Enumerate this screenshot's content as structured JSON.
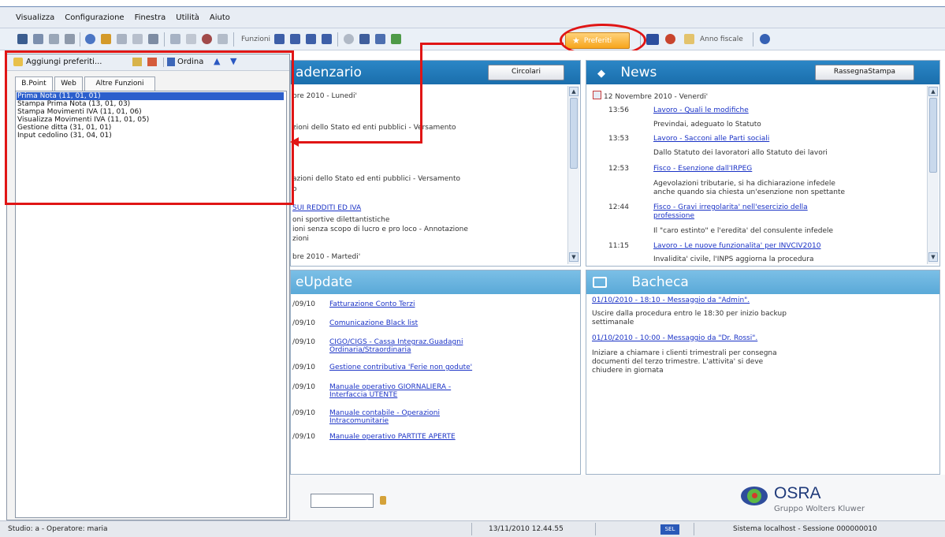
{
  "menu": [
    "Visualizza",
    "Configurazione",
    "Finestra",
    "Utilità",
    "Aiuto"
  ],
  "toolbar": {
    "funzioni_label": "Funzioni",
    "preferiti_label": "Preferiti",
    "anno_fiscale_label": "Anno fiscale"
  },
  "favorites": {
    "add_label": "Aggiungi preferiti...",
    "sort_label": "Ordina",
    "tabs": [
      "B.Point",
      "Web",
      "Altre Funzioni"
    ],
    "items": [
      "Prima Nota (11, 01, 01)",
      "Stampa Prima Nota (13, 01, 03)",
      "Stampa Movimenti IVA (11, 01, 06)",
      "Visualizza Movimenti IVA (11, 01, 05)",
      "Gestione ditta (31, 01, 01)",
      "Input cedolino (31, 04, 01)"
    ]
  },
  "scadenzario": {
    "title": "adenzario",
    "button": "Circolari",
    "lines": [
      "bre 2010 - Lunedi'",
      "zioni dello Stato ed enti pubblici - Versamento",
      "azioni dello Stato ed enti pubblici - Versamento",
      "o",
      "SUI REDDITI ED IVA",
      "oni  sportive  dilettantistiche",
      "ioni senza scopo di lucro e pro loco - Annotazione",
      "zioni",
      "bre 2010 - Martedi'"
    ]
  },
  "news": {
    "title": "News",
    "button": "RassegnaStampa",
    "date": "12 Novembre 2010 - Venerdi'",
    "items": [
      {
        "time": "13:56",
        "title": "Lavoro - Quali le modifiche",
        "desc": "Previndai, adeguato lo Statuto"
      },
      {
        "time": "13:53",
        "title": "Lavoro - Sacconi alle Parti sociali",
        "desc": "Dallo Statuto dei lavoratori allo Statuto dei lavori"
      },
      {
        "time": "12:53",
        "title": "Fisco - Esenzione dall'IRPEG",
        "desc": "Agevolazioni tributarie, si ha dichiarazione infedele",
        "desc2": "anche quando sia chiesta un'esenzione non spettante"
      },
      {
        "time": "12:44",
        "title": "Fisco - Gravi irregolarita' nell'esercizio della",
        "title2": "professione",
        "desc": "Il \"caro estinto\" e l'eredita' del consulente infedele"
      },
      {
        "time": "11:15",
        "title": "Lavoro - Le nuove funzionalita' per INVCIV2010",
        "desc": "Invalidita' civile, l'INPS aggiorna la procedura"
      }
    ]
  },
  "eupdate": {
    "title": "eUpdate",
    "items": [
      {
        "date": "/09/10",
        "title": "Fatturazione Conto Terzi"
      },
      {
        "date": "/09/10",
        "title": "Comunicazione Black list"
      },
      {
        "date": "/09/10",
        "title": "CIGO/CIGS - Cassa Integraz.Guadagni",
        "title2": "Ordinaria/Straordinaria"
      },
      {
        "date": "/09/10",
        "title": "Gestione contributiva 'Ferie non godute'"
      },
      {
        "date": "/09/10",
        "title": "Manuale operativo  GIORNALIERA -",
        "title2": "Interfaccia UTENTE"
      },
      {
        "date": "/09/10",
        "title": "Manuale contabile - Operazioni",
        "title2": "Intracomunitarie"
      },
      {
        "date": "/09/10",
        "title": "Manuale operativo PARTITE APERTE"
      }
    ]
  },
  "bacheca": {
    "title": "Bacheca",
    "messages": [
      {
        "header": "01/10/2010 - 18:10 - Messaggio da \"Admin\".",
        "body": [
          "Uscire dalla procedura entro le 18:30 per inizio backup",
          "settimanale"
        ]
      },
      {
        "header": "01/10/2010 - 10:00 - Messaggio da \"Dr. Rossi\".",
        "body": [
          "Iniziare a chiamare i clienti trimestrali per consegna",
          "documenti del terzo trimestre. L'attivita' si deve",
          "chiudere in giornata"
        ]
      }
    ]
  },
  "logo": {
    "name": "OSRA",
    "sub": "Gruppo Wolters Kluwer"
  },
  "status": {
    "left": "Studio: a - Operatore: maria",
    "datetime": "13/11/2010  12.44.55",
    "sel": "SEL",
    "right": "Sistema localhost - Sessione 000000010"
  },
  "colors": {
    "header": "#1f77b8",
    "header_light": "#6db5e0",
    "link": "#1a32c6",
    "highlight": "#e01515",
    "favorite": "#f7a51c"
  }
}
